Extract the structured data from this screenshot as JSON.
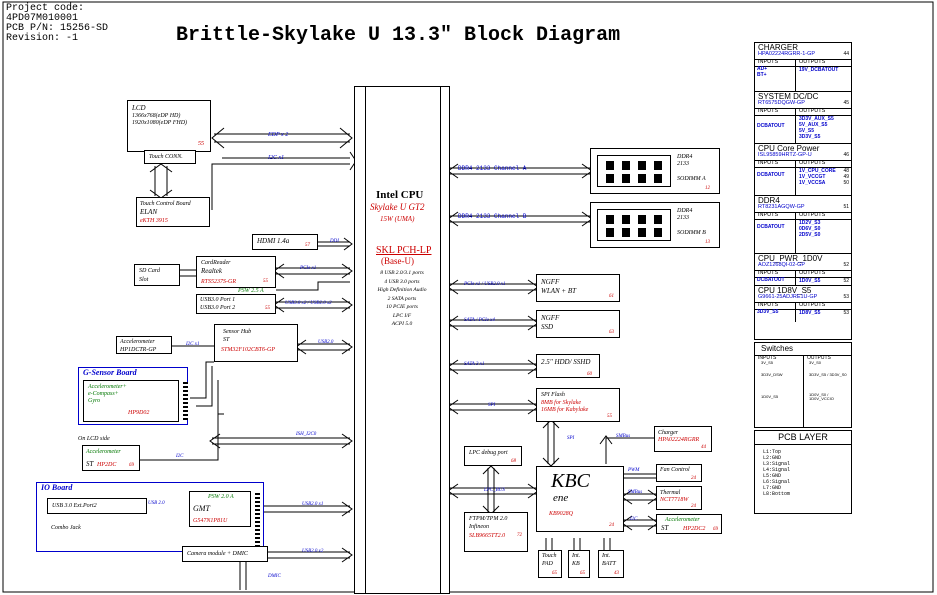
{
  "project": {
    "code": "Project code:",
    "code_value": "4PD07M010001",
    "pcb_pn": "PCB P/N: 15256-SD",
    "revision": "Revision: -1"
  },
  "title": "Brittle-Skylake U 13.3\" Block Diagram",
  "cpu": {
    "name": "Intel CPU",
    "model": "Skylake U GT2",
    "power": "15W (UMA)",
    "pch": "SKL PCH-LP",
    "pch_sub": "(Base-U)",
    "features": [
      "8 USB 2.0/3.1 ports",
      "4 USB 3.0 ports",
      "High Definition Audio",
      "2 SATA ports",
      "10 PCIE ports",
      "LPC I/F",
      "ACPI 5.0"
    ]
  },
  "lcd": {
    "title": "LCD",
    "line1": "1366x768(eDP HD)",
    "line2": "1920x1080(eDP FHD)",
    "page": "55",
    "touch": "Touch CONN."
  },
  "touch_board": {
    "title": "Touch Control Board",
    "name": "ELAN",
    "part": "eKTH 3915"
  },
  "links": {
    "edp": "EDP x 2",
    "i2c_x1": "I2C x1",
    "ddi": "DDI",
    "pcie_x1": "PCIe x1",
    "usb_ports": "USB3.0 x2 / USB2.0 x2",
    "usb20": "USB2.0",
    "i2c_x1b": "I2C x1",
    "ish_i2c0": "ISH_I2C0",
    "i2c": "I2C",
    "usb20_x1": "USB2.0 x1",
    "usb20_x2": "USB2.0 x2",
    "usb20b": "USB 2.0",
    "dmic": "DMIC",
    "psw": "PSW 2.5 A",
    "ddr_a": "DDR4 2133 Channel A",
    "ddr_b": "DDR4 2133 Channel B",
    "pcie_usb": "PCIe x1 / USB2.0 x1",
    "sata_pcie": "SATA / PCIe x4",
    "sata": "SATA 3 x1",
    "spi": "SPI",
    "spi2": "SPI",
    "lpc_bus": "LPC_BUS",
    "smbus": "SMBus",
    "pwm": "PWM",
    "smbus2": "SMBus",
    "i2c2": "I2C"
  },
  "hdmi": {
    "label": "HDMI 1.4a",
    "page": "57"
  },
  "cardreader": {
    "title": "CardReader",
    "name": "Realtek",
    "part": "RTS5237S-GR",
    "page": "55"
  },
  "sdcard": {
    "line1": "SD Card",
    "line2": "Slot"
  },
  "usb_ports": {
    "line1": "USB3.0 Port 1",
    "line2": "USB3.0 Port 2",
    "page": "55"
  },
  "accel1": {
    "title": "Accelerometer",
    "part": "HP1DCTR-GP"
  },
  "sensor_hub": {
    "title": "Sensor Hub",
    "vendor": "ST",
    "part": "STM32F102CBT6-GP"
  },
  "gsensor": {
    "title": "G-Sensor Board",
    "line1": "Accelerometer+",
    "line2": "e-Compass+",
    "line3": "Gyro",
    "part": "HP9D02"
  },
  "lcd_side": {
    "label": "On LCD side",
    "title": "Accelerometer",
    "vendor": "ST",
    "part": "HP2DC",
    "page": "69"
  },
  "io_board": {
    "title": "IO Board",
    "usb_port": "USB 3.0 Ext.Port2",
    "gmt": "GMT",
    "gmt_psw": "PSW 2.0 A",
    "gmt_part": "G547N1P81U",
    "combo": "Combo Jack"
  },
  "camera": {
    "label": "Camera module + DMIC"
  },
  "ddr": [
    {
      "name": "DDR4",
      "speed": "2133",
      "slot": "SODIMM A",
      "page": "12"
    },
    {
      "name": "DDR4",
      "speed": "2133",
      "slot": "SODIMM B",
      "page": "13"
    }
  ],
  "ngff_wlan": {
    "title": "NGFF",
    "sub": "WLAN + BT",
    "page": "61"
  },
  "ngff_ssd": {
    "title": "NGFF",
    "sub": "SSD",
    "page": "63"
  },
  "hdd": {
    "label": "2.5\" HDD/ SSHD",
    "page": "60"
  },
  "spi_flash": {
    "title": "SPI Flash",
    "line1": "8MB  for Skylake",
    "line2": "16MB for Kabylake",
    "page": "55"
  },
  "lpc_debug": {
    "label": "LPC debug port",
    "page": "68"
  },
  "tpm": {
    "title": "FTPM/TPM 2.0",
    "vendor": "Infineon",
    "part": "SLB9665TT2.0",
    "page": "72"
  },
  "kbc": {
    "title": "KBC",
    "sub": "ene",
    "part": "KB9028Q",
    "page": "24"
  },
  "charger_blk": {
    "title": "Charger",
    "part": "HPA02224RGRR",
    "page": "44"
  },
  "fan": {
    "label": "Fan Control",
    "page": "24"
  },
  "thermal": {
    "title": "Thermal",
    "part": "NCT7718W",
    "page": "24"
  },
  "accel_kbc": {
    "title": "Accelerometer",
    "vendor": "ST",
    "part": "HP2DC2",
    "page": "69"
  },
  "bottom_boxes": [
    {
      "line1": "Touch",
      "line2": "PAD",
      "page": "65"
    },
    {
      "line1": "Int.",
      "line2": "KB",
      "page": "65"
    },
    {
      "line1": "Int.",
      "line2": "BATT",
      "page": "43"
    }
  ],
  "power_table": {
    "sections": [
      {
        "title": "CHARGER",
        "part": "HPA02224RGRR-1-GP",
        "page": "44",
        "in_hdr": "INPUTS",
        "out_hdr": "OUTPUTS",
        "inputs": [
          "AD+",
          "BT+"
        ],
        "outputs": [
          "19V_DCBATOUT"
        ],
        "pages": []
      },
      {
        "title": "SYSTEM DC/DC",
        "part": "RT6575DQGW-GP",
        "page": "45",
        "in_hdr": "INPUTS",
        "out_hdr": "OUTPUTS",
        "inputs": [
          "DCBATOUT"
        ],
        "outputs": [
          "3D3V_AUX_S5",
          "5V_AUX_S5",
          "5V_S5",
          "3D3V_S5"
        ],
        "pages": []
      },
      {
        "title": "CPU Core Power",
        "part": "ISL95859HRTZ-GP-U",
        "page": "46",
        "in_hdr": "INPUTS",
        "out_hdr": "OUTPUTS",
        "inputs": [
          "DCBATOUT"
        ],
        "outputs": [
          "1V_CPU_CORE",
          "1V_VCCGT",
          "1V_VCCSA"
        ],
        "pages": [
          "48",
          "49",
          "50"
        ]
      },
      {
        "title": "DDR4",
        "part": "RT8231AGQW-GP",
        "page": "51",
        "in_hdr": "INPUTS",
        "out_hdr": "OUTPUTS",
        "inputs": [
          "DCBATOUT"
        ],
        "outputs": [
          "1D2V_S3",
          "0D6V_S0",
          "2D5V_S0"
        ],
        "pages": []
      },
      {
        "title": "CPU_PWR_1D0V",
        "part": "AOZ1268QI-02-GP",
        "page": "52",
        "in_hdr": "INPUTS",
        "out_hdr": "OUTPUTS",
        "inputs": [
          "DCBATOUT"
        ],
        "outputs": [
          "1D0V_S5"
        ],
        "pages": [
          "52"
        ]
      },
      {
        "title": "CPU 1D8V_S5",
        "part": "G9661-25ADJRE1U-GP",
        "page": "53",
        "in_hdr": "INPUTS",
        "out_hdr": "OUTPUTS",
        "inputs": [
          "3D3V_S5"
        ],
        "outputs": [
          "1D8V_S5"
        ],
        "pages": [
          "53"
        ]
      }
    ],
    "switches": {
      "title": "Switches",
      "in_hdr": "INPUTS",
      "out_hdr": "OUTPUTS",
      "rows": [
        {
          "in": "3V_S5",
          "out": "3V_S0"
        },
        {
          "in": "3D3V_DSW",
          "out": "3D3V_S5 / 3D3V_S0"
        },
        {
          "in": "1D0V_S5",
          "out": "1D0V_S0 / 1D0V_VCCIO"
        }
      ]
    },
    "pcb_layer": {
      "title": "PCB LAYER",
      "layers": [
        "L1:Top",
        "L2:GND",
        "L3:Signal",
        "L4:Signal",
        "L5:GND",
        "L6:Signal",
        "L7:GND",
        "L8:Bottom"
      ]
    }
  }
}
